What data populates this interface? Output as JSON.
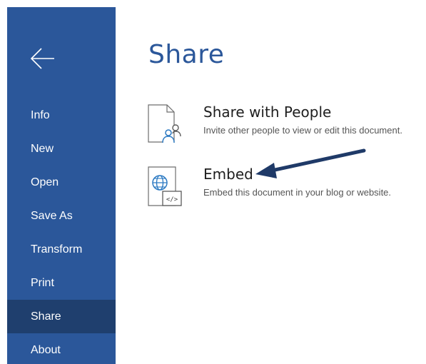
{
  "sidebar": {
    "back_icon": "arrow-left-icon",
    "items": [
      {
        "label": "Info"
      },
      {
        "label": "New"
      },
      {
        "label": "Open"
      },
      {
        "label": "Save As"
      },
      {
        "label": "Transform"
      },
      {
        "label": "Print"
      },
      {
        "label": "Share",
        "active": true
      },
      {
        "label": "About"
      }
    ]
  },
  "main": {
    "title": "Share",
    "options": [
      {
        "icon": "share-with-people-icon",
        "title": "Share with People",
        "description": "Invite other people to view or edit this document."
      },
      {
        "icon": "embed-icon",
        "title": "Embed",
        "description": "Embed this document in your blog or website."
      }
    ]
  },
  "colors": {
    "sidebar_bg": "#2b579a",
    "sidebar_active_bg": "#1f3f6e",
    "title_color": "#2b579a",
    "annotation_arrow": "#1f3a68"
  }
}
